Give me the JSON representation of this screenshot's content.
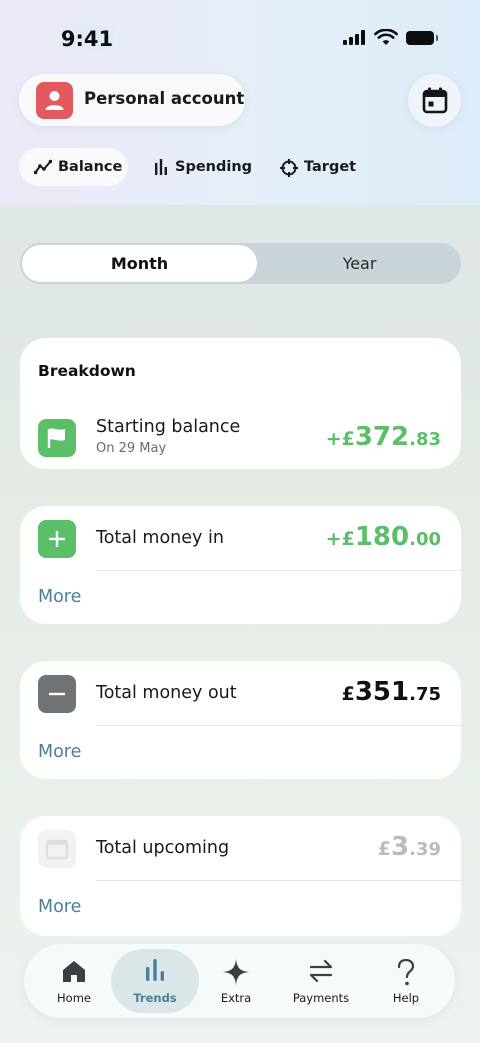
{
  "status_bar": {
    "time": "9:41"
  },
  "header": {
    "account_label": "Personal account",
    "tabs": [
      {
        "label": "Balance",
        "icon": "line-chart-icon",
        "selected": true
      },
      {
        "label": "Spending",
        "icon": "bar-chart-icon",
        "selected": false
      },
      {
        "label": "Target",
        "icon": "crosshair-icon",
        "selected": false
      }
    ]
  },
  "period_toggle": {
    "options": [
      "Month",
      "Year"
    ],
    "selected": "Month"
  },
  "breakdown": {
    "title": "Breakdown",
    "starting_balance": {
      "label": "Starting balance",
      "sub": "On 29 May",
      "amount_sign": "+£",
      "amount_whole": "372",
      "amount_dec": ".83"
    }
  },
  "money_in": {
    "label": "Total money in",
    "amount_sign": "+£",
    "amount_whole": "180",
    "amount_dec": ".00",
    "more": "More"
  },
  "money_out": {
    "label": "Total money out",
    "amount_sign": "£",
    "amount_whole": "351",
    "amount_dec": ".75",
    "more": "More"
  },
  "upcoming": {
    "label": "Total upcoming",
    "amount_sign": "£",
    "amount_whole": "3",
    "amount_dec": ".39",
    "more": "More"
  },
  "bottom_nav": [
    {
      "label": "Home",
      "icon": "home-icon"
    },
    {
      "label": "Trends",
      "icon": "trends-icon",
      "active": true
    },
    {
      "label": "Extra",
      "icon": "sparkle-icon"
    },
    {
      "label": "Payments",
      "icon": "transfer-arrows-icon"
    },
    {
      "label": "Help",
      "icon": "question-icon"
    }
  ],
  "colors": {
    "positive": "#5bbf6a",
    "negative_icon": "#6f7376",
    "link": "#4b7f98",
    "account_icon": "#e25a5f"
  }
}
